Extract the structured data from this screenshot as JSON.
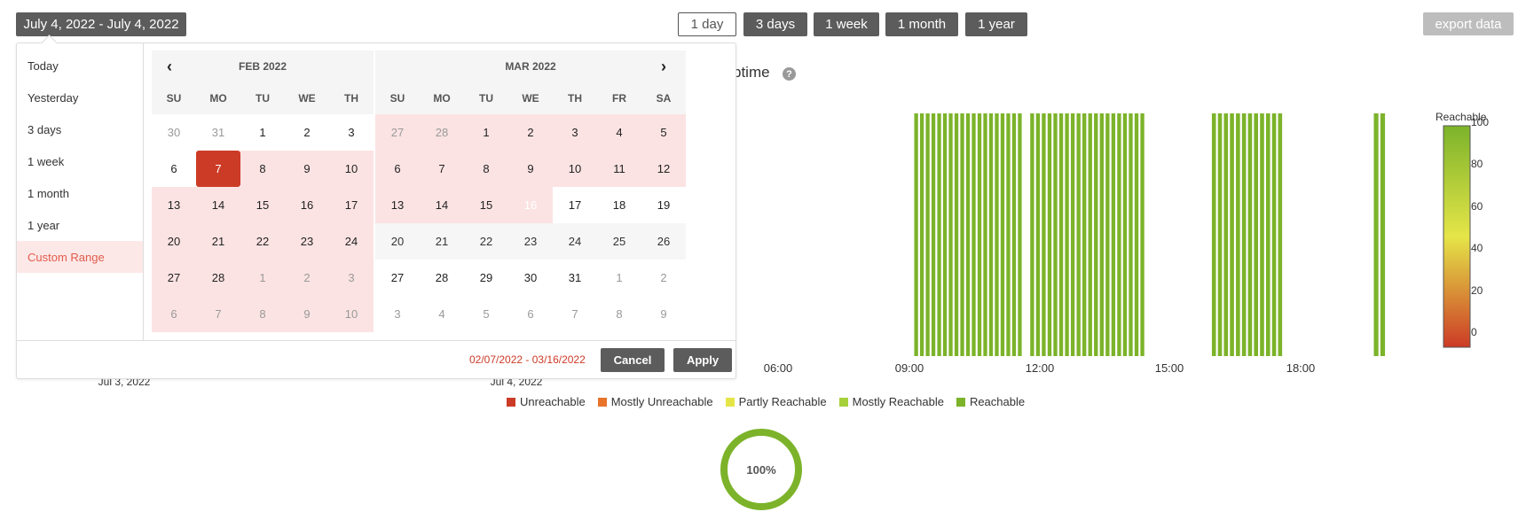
{
  "header": {
    "date_range_button": "July 4, 2022 - July 4, 2022",
    "periods": [
      {
        "label": "1 day",
        "active": true
      },
      {
        "label": "3 days",
        "active": false
      },
      {
        "label": "1 week",
        "active": false
      },
      {
        "label": "1 month",
        "active": false
      },
      {
        "label": "1 year",
        "active": false
      }
    ],
    "export_label": "export data"
  },
  "chart": {
    "title": "ptime",
    "help_icon": "question-circle-icon",
    "x_ticks": [
      "06:00",
      "09:00",
      "12:00",
      "15:00",
      "18:00"
    ],
    "date_ticks": [
      "Jul 3, 2022",
      "Jul 4, 2022"
    ],
    "scale_title": "Reachable",
    "scale_ticks": [
      "100",
      "80",
      "60",
      "40",
      "20",
      "0"
    ],
    "legend": [
      {
        "label": "Unreachable",
        "color": "#cc3b26"
      },
      {
        "label": "Mostly Unreachable",
        "color": "#e8732a"
      },
      {
        "label": "Partly Reachable",
        "color": "#e5e548"
      },
      {
        "label": "Mostly Reachable",
        "color": "#a6d13a"
      },
      {
        "label": "Reachable",
        "color": "#7cb32a"
      }
    ],
    "donut_label": "100%"
  },
  "chart_data": {
    "type": "bar",
    "x_unit": "hour of day",
    "value_unit": "percent reachable",
    "series": [
      {
        "name": "Reachable",
        "x_start": 8.3,
        "x_end": 10.8,
        "bar_count": 19,
        "value": 100
      },
      {
        "name": "Reachable",
        "x_start": 10.95,
        "x_end": 13.6,
        "bar_count": 20,
        "value": 100
      },
      {
        "name": "Reachable",
        "x_start": 15.1,
        "x_end": 16.75,
        "bar_count": 12,
        "value": 100
      },
      {
        "name": "Reachable",
        "x_start": 18.8,
        "x_end": 19.1,
        "bar_count": 2,
        "value": 100
      }
    ],
    "colors": {
      "bar": "#7cb32a",
      "scale_top": "#7cb32a",
      "scale_mid": "#e5e548",
      "scale_bottom": "#cc3b26"
    }
  },
  "picker": {
    "ranges": [
      {
        "label": "Today",
        "active": false
      },
      {
        "label": "Yesterday",
        "active": false
      },
      {
        "label": "3 days",
        "active": false
      },
      {
        "label": "1 week",
        "active": false
      },
      {
        "label": "1 month",
        "active": false
      },
      {
        "label": "1 year",
        "active": false
      },
      {
        "label": "Custom Range",
        "active": true
      }
    ],
    "left_month": "FEB 2022",
    "right_month": "MAR 2022",
    "left_dows": [
      "SU",
      "MO",
      "TU",
      "WE",
      "TH"
    ],
    "right_dows": [
      "SU",
      "MO",
      "TU",
      "WE",
      "TH",
      "FR",
      "SA"
    ],
    "left_days": [
      [
        {
          "d": "30",
          "s": "off"
        },
        {
          "d": "31",
          "s": "off"
        },
        {
          "d": "1",
          "s": ""
        },
        {
          "d": "2",
          "s": ""
        },
        {
          "d": "3",
          "s": ""
        }
      ],
      [
        {
          "d": "6",
          "s": ""
        },
        {
          "d": "7",
          "s": "start"
        },
        {
          "d": "8",
          "s": "in"
        },
        {
          "d": "9",
          "s": "in"
        },
        {
          "d": "10",
          "s": "in"
        }
      ],
      [
        {
          "d": "13",
          "s": "in"
        },
        {
          "d": "14",
          "s": "in"
        },
        {
          "d": "15",
          "s": "in"
        },
        {
          "d": "16",
          "s": "in"
        },
        {
          "d": "17",
          "s": "in"
        }
      ],
      [
        {
          "d": "20",
          "s": "in"
        },
        {
          "d": "21",
          "s": "in"
        },
        {
          "d": "22",
          "s": "in"
        },
        {
          "d": "23",
          "s": "in"
        },
        {
          "d": "24",
          "s": "in"
        }
      ],
      [
        {
          "d": "27",
          "s": "in"
        },
        {
          "d": "28",
          "s": "in"
        },
        {
          "d": "1",
          "s": "in-off"
        },
        {
          "d": "2",
          "s": "in-off"
        },
        {
          "d": "3",
          "s": "in-off"
        }
      ],
      [
        {
          "d": "6",
          "s": "in-off"
        },
        {
          "d": "7",
          "s": "in-off"
        },
        {
          "d": "8",
          "s": "in-off"
        },
        {
          "d": "9",
          "s": "in-off"
        },
        {
          "d": "10",
          "s": "in-off"
        }
      ]
    ],
    "right_days": [
      [
        {
          "d": "27",
          "s": "in-off"
        },
        {
          "d": "28",
          "s": "in-off"
        },
        {
          "d": "1",
          "s": "in"
        },
        {
          "d": "2",
          "s": "in"
        },
        {
          "d": "3",
          "s": "in"
        },
        {
          "d": "4",
          "s": "in"
        },
        {
          "d": "5",
          "s": "in"
        }
      ],
      [
        {
          "d": "6",
          "s": "in"
        },
        {
          "d": "7",
          "s": "in"
        },
        {
          "d": "8",
          "s": "in"
        },
        {
          "d": "9",
          "s": "in"
        },
        {
          "d": "10",
          "s": "in"
        },
        {
          "d": "11",
          "s": "in"
        },
        {
          "d": "12",
          "s": "in"
        }
      ],
      [
        {
          "d": "13",
          "s": "in"
        },
        {
          "d": "14",
          "s": "in"
        },
        {
          "d": "15",
          "s": "in"
        },
        {
          "d": "16",
          "s": "end"
        },
        {
          "d": "17",
          "s": ""
        },
        {
          "d": "18",
          "s": ""
        },
        {
          "d": "19",
          "s": ""
        }
      ],
      [
        {
          "d": "20",
          "s": "gray"
        },
        {
          "d": "21",
          "s": "gray"
        },
        {
          "d": "22",
          "s": "gray"
        },
        {
          "d": "23",
          "s": "gray"
        },
        {
          "d": "24",
          "s": "gray"
        },
        {
          "d": "25",
          "s": "gray"
        },
        {
          "d": "26",
          "s": "gray"
        }
      ],
      [
        {
          "d": "27",
          "s": ""
        },
        {
          "d": "28",
          "s": ""
        },
        {
          "d": "29",
          "s": ""
        },
        {
          "d": "30",
          "s": ""
        },
        {
          "d": "31",
          "s": ""
        },
        {
          "d": "1",
          "s": "off"
        },
        {
          "d": "2",
          "s": "off"
        }
      ],
      [
        {
          "d": "3",
          "s": "off"
        },
        {
          "d": "4",
          "s": "off"
        },
        {
          "d": "5",
          "s": "off"
        },
        {
          "d": "6",
          "s": "off"
        },
        {
          "d": "7",
          "s": "off"
        },
        {
          "d": "8",
          "s": "off"
        },
        {
          "d": "9",
          "s": "off"
        }
      ]
    ],
    "prev_icon": "chevron-left-icon",
    "next_icon": "chevron-right-icon",
    "selected_range_text": "02/07/2022 - 03/16/2022",
    "cancel_label": "Cancel",
    "apply_label": "Apply"
  }
}
